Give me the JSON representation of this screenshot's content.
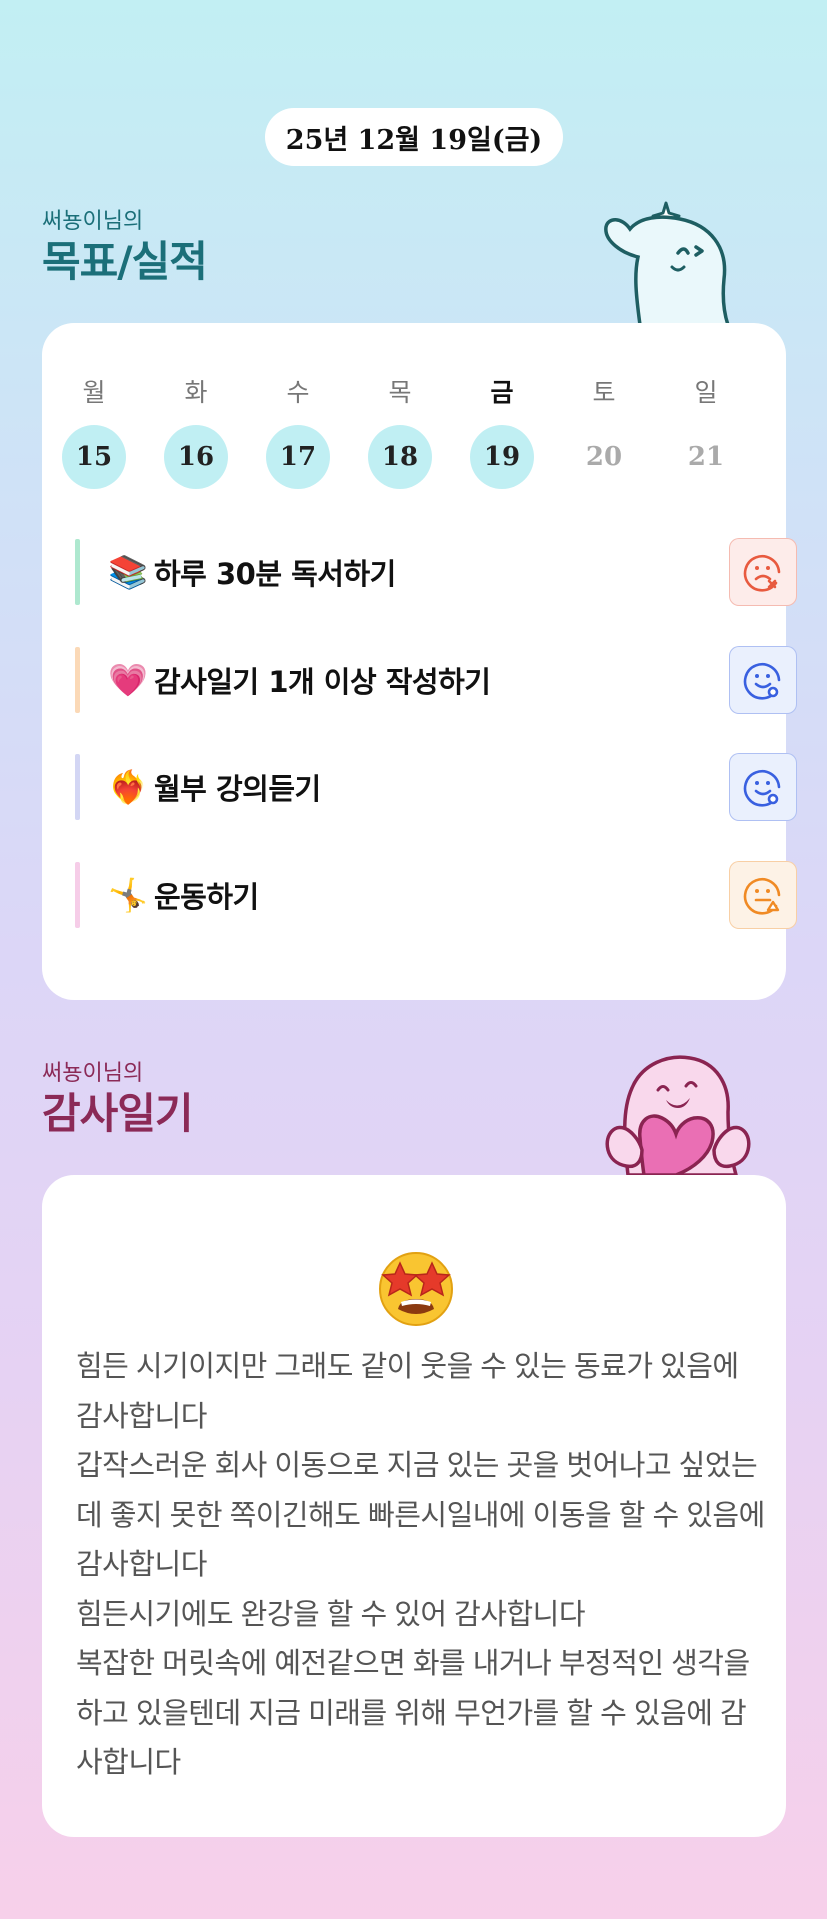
{
  "header": {
    "date": "25년 12월 19일(금)"
  },
  "goals_section": {
    "subtitle": "써뇽이님의",
    "title": "목표/실적"
  },
  "week": {
    "days": [
      {
        "weekday": "월",
        "date": "15",
        "state": "done"
      },
      {
        "weekday": "화",
        "date": "16",
        "state": "done"
      },
      {
        "weekday": "수",
        "date": "17",
        "state": "done"
      },
      {
        "weekday": "목",
        "date": "18",
        "state": "done"
      },
      {
        "weekday": "금",
        "date": "19",
        "state": "today"
      },
      {
        "weekday": "토",
        "date": "20",
        "state": "future"
      },
      {
        "weekday": "일",
        "date": "21",
        "state": "future"
      }
    ]
  },
  "goals": [
    {
      "emoji": "📚",
      "label": "하루 30분 독서하기",
      "bar_color": "#aee8cf",
      "status": "fail",
      "status_icon": "sad-face-x-icon"
    },
    {
      "emoji": "💗",
      "label": "감사일기 1개 이상 작성하기",
      "bar_color": "#fbd9b7",
      "status": "done",
      "status_icon": "smile-face-check-icon"
    },
    {
      "emoji": "❤️‍🔥",
      "label": "월부 강의듣기",
      "bar_color": "#d3d6f4",
      "status": "done",
      "status_icon": "smile-face-check-icon"
    },
    {
      "emoji": "🤸",
      "label": "운동하기",
      "bar_color": "#f6cde8",
      "status": "partial",
      "status_icon": "neutral-face-triangle-icon"
    }
  ],
  "colors": {
    "fail": "#e85a3f",
    "fail_bg": "#fdecea",
    "done": "#3960e0",
    "done_bg": "#eaf0fd",
    "partial": "#f08a24",
    "partial_bg": "#fdf2e6",
    "goals_title": "#1b6f79",
    "diary_title": "#8b2a57"
  },
  "diary_section": {
    "subtitle": "써뇽이님의",
    "title": "감사일기"
  },
  "diary": {
    "emoji": "🤩",
    "text": "힘든 시기이지만 그래도 같이 웃을 수 있는 동료가 있음에 감사합니다\n갑작스러운 회사 이동으로 지금 있는 곳을 벗어나고 싶었는데 좋지 못한 쪽이긴해도 빠른시일내에 이동을 할 수 있음에 감사합니다\n힘든시기에도 완강을 할 수 있어 감사합니다\n복잡한 머릿속에 예전같으면 화를 내거나 부정적인 생각을 하고 있을텐데 지금 미래를 위해 무언가를 할 수 있음에 감사합니다"
  }
}
